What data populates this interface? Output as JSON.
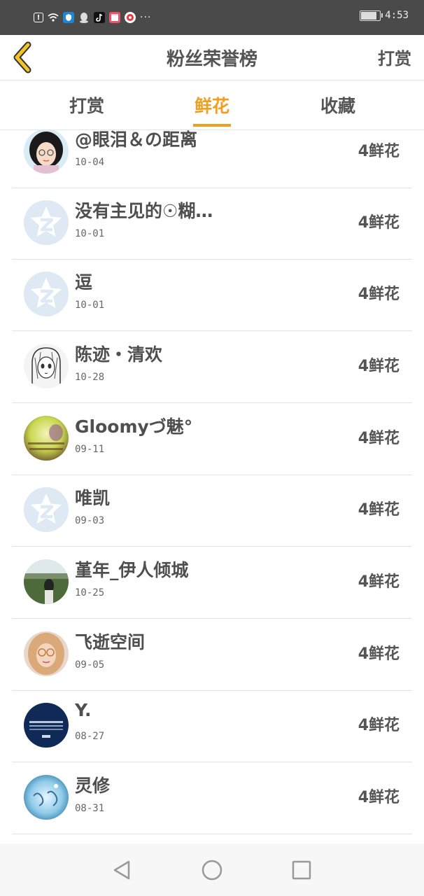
{
  "status_bar": {
    "time": "4:53",
    "icons": [
      "alert-icon",
      "wifi-icon",
      "shield-app-icon",
      "qq-icon",
      "tiktok-icon",
      "calendar-app-icon",
      "red-app-icon"
    ],
    "more": "···"
  },
  "header": {
    "title": "粉丝荣誉榜",
    "right_link": "打赏"
  },
  "tabs": [
    {
      "label": "打赏",
      "active": false
    },
    {
      "label": "鲜花",
      "active": true
    },
    {
      "label": "收藏",
      "active": false
    }
  ],
  "accent_color": "#f0a020",
  "fans": [
    {
      "name": "@眼泪＆の距离",
      "date": "10-04",
      "value": "4鲜花",
      "avatar": "anime-girl-glasses"
    },
    {
      "name": "没有主见的☉糊…",
      "date": "10-01",
      "value": "4鲜花",
      "avatar": "default-star"
    },
    {
      "name": "逗",
      "date": "10-01",
      "value": "4鲜花",
      "avatar": "default-star"
    },
    {
      "name": "陈迹・清欢",
      "date": "10-28",
      "value": "4鲜花",
      "avatar": "sketch-girl"
    },
    {
      "name": "Gloomyづ魅°",
      "date": "09-11",
      "value": "4鲜花",
      "avatar": "yellow-photo"
    },
    {
      "name": "唯凯",
      "date": "09-03",
      "value": "4鲜花",
      "avatar": "default-star"
    },
    {
      "name": "堇年_伊人倾城",
      "date": "10-25",
      "value": "4鲜花",
      "avatar": "field-photo"
    },
    {
      "name": "飞逝空间",
      "date": "09-05",
      "value": "4鲜花",
      "avatar": "girl-glasses-photo"
    },
    {
      "name": "Y.",
      "date": "08-27",
      "value": "4鲜花",
      "avatar": "navy-city"
    },
    {
      "name": "灵修",
      "date": "08-31",
      "value": "4鲜花",
      "avatar": "calligraphy-blue"
    }
  ]
}
